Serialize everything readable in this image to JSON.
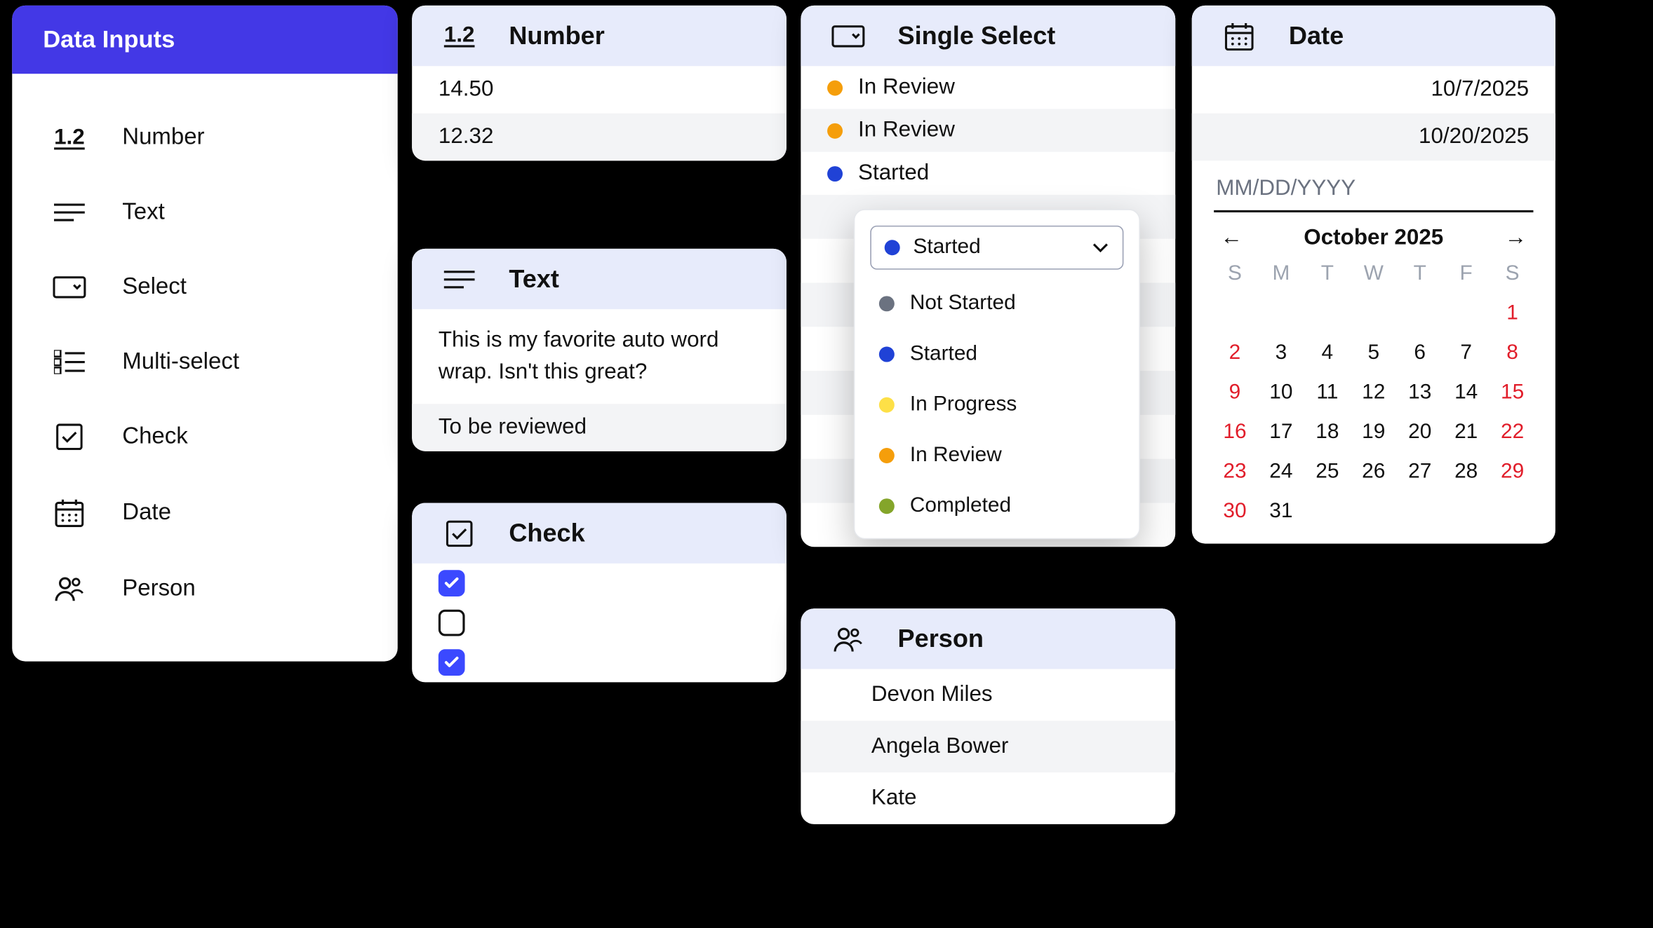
{
  "sidebar": {
    "title": "Data Inputs",
    "items": [
      {
        "label": "Number"
      },
      {
        "label": "Text"
      },
      {
        "label": "Select"
      },
      {
        "label": "Multi-select"
      },
      {
        "label": "Check"
      },
      {
        "label": "Date"
      },
      {
        "label": "Person"
      }
    ]
  },
  "number": {
    "title": "Number",
    "values": [
      "14.50",
      "12.32"
    ]
  },
  "text": {
    "title": "Text",
    "body": "This is my favorite auto word wrap. Isn't this great?",
    "footer": "To be reviewed"
  },
  "check": {
    "title": "Check",
    "values": [
      true,
      false,
      true
    ]
  },
  "select": {
    "title": "Single Select",
    "rows": [
      {
        "label": "In Review",
        "color": "#f59e0b"
      },
      {
        "label": "In Review",
        "color": "#f59e0b"
      },
      {
        "label": "Started",
        "color": "#2042d6"
      }
    ],
    "selected": {
      "label": "Started",
      "color": "#2042d6"
    },
    "options": [
      {
        "label": "Not Started",
        "color": "#6b7280"
      },
      {
        "label": "Started",
        "color": "#2042d6"
      },
      {
        "label": "In Progress",
        "color": "#fde047"
      },
      {
        "label": "In Review",
        "color": "#f59e0b"
      },
      {
        "label": "Completed",
        "color": "#84a52a"
      }
    ],
    "placeholderRows": 8
  },
  "person": {
    "title": "Person",
    "values": [
      "Devon Miles",
      "Angela Bower",
      "Kate"
    ]
  },
  "date": {
    "title": "Date",
    "values": [
      "10/7/2025",
      "10/20/2025"
    ],
    "placeholder": "MM/DD/YYYY",
    "month": "October 2025",
    "dow": [
      "S",
      "M",
      "T",
      "W",
      "T",
      "F",
      "S"
    ],
    "weeks": [
      [
        "",
        "",
        "",
        "",
        "",
        "",
        "1"
      ],
      [
        "2",
        "3",
        "4",
        "5",
        "6",
        "7",
        "8"
      ],
      [
        "9",
        "10",
        "11",
        "12",
        "13",
        "14",
        "15"
      ],
      [
        "16",
        "17",
        "18",
        "19",
        "20",
        "21",
        "22"
      ],
      [
        "23",
        "24",
        "25",
        "26",
        "27",
        "28",
        "29"
      ],
      [
        "30",
        "31",
        "",
        "",
        "",
        "",
        ""
      ]
    ]
  },
  "number_icon_text": "1.2"
}
